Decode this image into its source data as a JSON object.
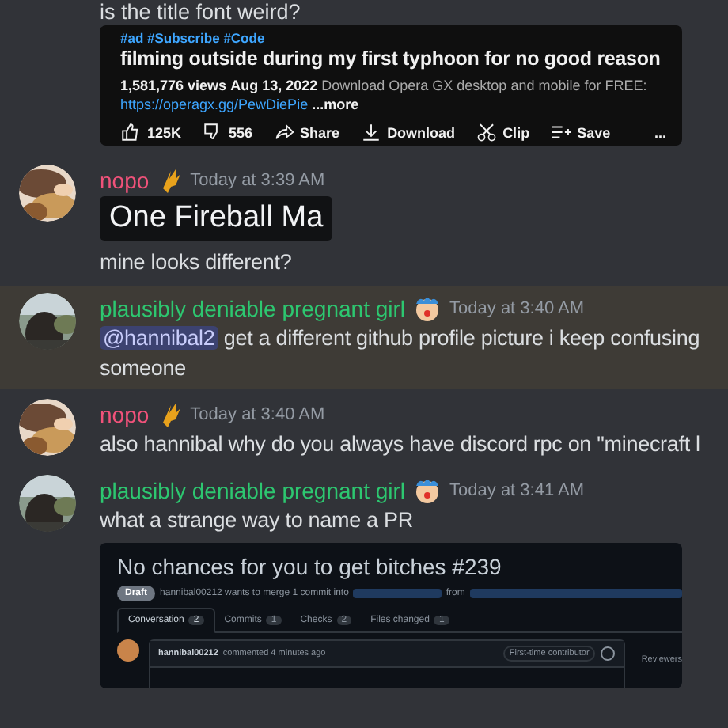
{
  "previous_message": {
    "text": "is the title font weird?"
  },
  "video_embed": {
    "hashtags": "#ad #Subscribe #Code",
    "title": "filming outside during my first typhoon for no good reason",
    "views": "1,581,776 views",
    "date": "Aug 13, 2022",
    "description": "Download Opera GX desktop and mobile for FREE:",
    "link": "https://operagx.gg/PewDiePie",
    "more": "...more",
    "actions": [
      {
        "kind": "like",
        "label": "125K"
      },
      {
        "kind": "dislike",
        "label": "556"
      },
      {
        "kind": "share",
        "label": "Share"
      },
      {
        "kind": "download",
        "label": "Download"
      },
      {
        "kind": "clip",
        "label": "Clip"
      },
      {
        "kind": "save",
        "label": "Save"
      },
      {
        "kind": "more",
        "label": "..."
      }
    ]
  },
  "messages": [
    {
      "author": "nopo",
      "color": "#f0527a",
      "badge": {
        "kind": "flame"
      },
      "time": "Today at 3:39 AM",
      "highlighted": false,
      "image_text": "One Fireball Ma",
      "text": "mine looks different?"
    },
    {
      "author": "plausibly deniable pregnant girl",
      "color": "#2dc770",
      "badge": {
        "kind": "clown"
      },
      "time": "Today at 3:40 AM",
      "highlighted": true,
      "mention": "@hannibal2",
      "text": "get a different github profile picture i keep confusing someone"
    },
    {
      "author": "nopo",
      "color": "#f0527a",
      "badge": {
        "kind": "flame"
      },
      "time": "Today at 3:40 AM",
      "highlighted": false,
      "text": "also hannibal why do you always have discord rpc on \"minecraft l"
    },
    {
      "author": "plausibly deniable pregnant girl",
      "color": "#2dc770",
      "badge": {
        "kind": "clown"
      },
      "time": "Today at 3:41 AM",
      "highlighted": false,
      "text": "what a strange way to name a PR",
      "github": {
        "title": "No chances for you to get bitches #239",
        "status": "Draft",
        "merge_text": "hannibal00212 wants to merge 1 commit into",
        "from_text": "from",
        "tabs": [
          {
            "label": "Conversation",
            "count": "2",
            "selected": true
          },
          {
            "label": "Commits",
            "count": "1",
            "selected": false
          },
          {
            "label": "Checks",
            "count": "2",
            "selected": false
          },
          {
            "label": "Files changed",
            "count": "1",
            "selected": false
          }
        ],
        "comment_author": "hannibal00212",
        "comment_meta": "commented 4 minutes ago",
        "comment_badge": "First-time contributor",
        "sidebar_heading": "Reviewers"
      }
    }
  ]
}
